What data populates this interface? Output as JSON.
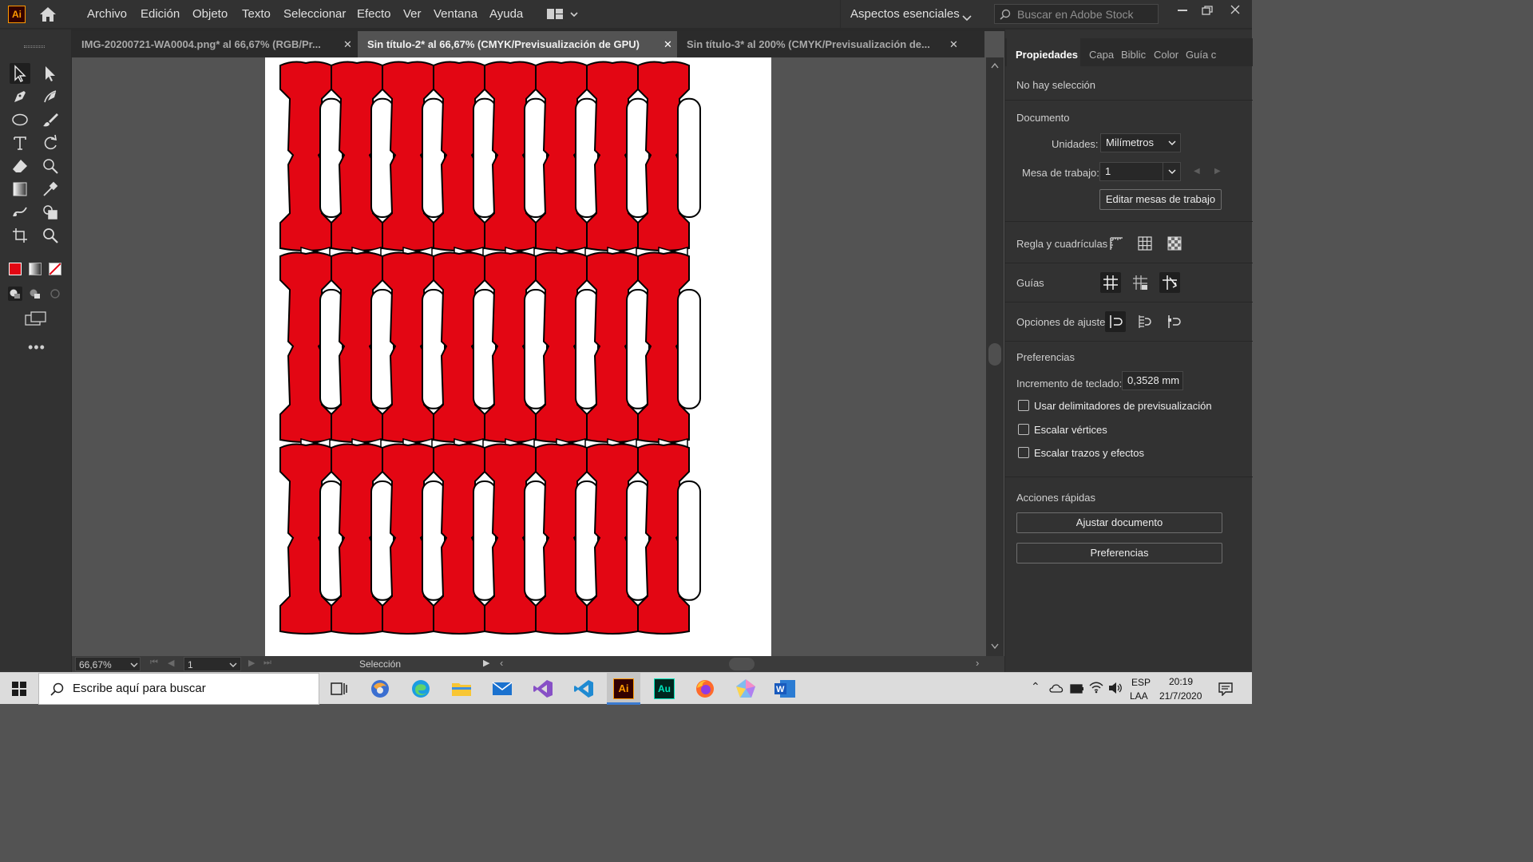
{
  "app": {
    "logo": "Ai",
    "menu": [
      "Archivo",
      "Edición",
      "Objeto",
      "Texto",
      "Seleccionar",
      "Efecto",
      "Ver",
      "Ventana",
      "Ayuda"
    ],
    "workspace": "Aspectos esenciales",
    "stock_search_placeholder": "Buscar en Adobe Stock"
  },
  "tabs": [
    {
      "label": "IMG-20200721-WA0004.png* al 66,67% (RGB/Pr...",
      "active": false
    },
    {
      "label": "Sin título-2* al 66,67% (CMYK/Previsualización de GPU)",
      "active": true
    },
    {
      "label": "Sin título-3* al 200% (CMYK/Previsualización de...",
      "active": false
    }
  ],
  "status": {
    "zoom": "66,67%",
    "artboard": "1",
    "tool": "Selección"
  },
  "panel": {
    "tabs": [
      "Propiedades",
      "Capa",
      "Biblic",
      "Color",
      "Guía c"
    ],
    "no_selection": "No hay selección",
    "document_title": "Documento",
    "units_label": "Unidades:",
    "units_value": "Milímetros",
    "artboard_label": "Mesa de trabajo:",
    "artboard_value": "1",
    "edit_artboards": "Editar mesas de trabajo",
    "ruler_grid": "Regla y cuadrículas",
    "guides": "Guías",
    "snap_options": "Opciones de ajuste",
    "preferences_title": "Preferencias",
    "keyboard_increment_label": "Incremento de teclado:",
    "keyboard_increment_value": "0,3528 mm",
    "checkboxes": [
      "Usar delimitadores de previsualización",
      "Escalar vértices",
      "Escalar trazos y efectos"
    ],
    "quick_actions_title": "Acciones rápidas",
    "btn_fit_document": "Ajustar documento",
    "btn_preferences": "Preferencias"
  },
  "taskbar": {
    "search_placeholder": "Escribe aquí para buscar",
    "lang_top": "ESP",
    "lang_bottom": "LAA",
    "time": "20:19",
    "date": "21/7/2020"
  },
  "colors": {
    "fill": "#e30613",
    "accent_ai": "#ff9a00"
  }
}
